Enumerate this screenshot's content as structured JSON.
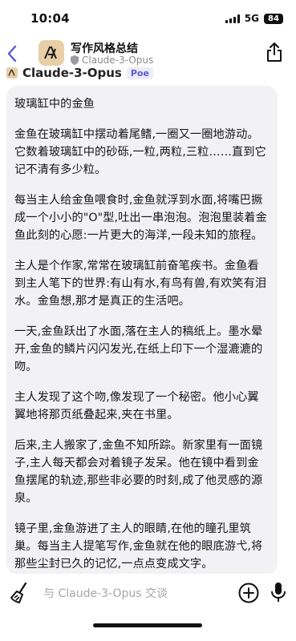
{
  "status_bar": {
    "time": "10:04",
    "network": "5G",
    "battery": "84"
  },
  "header": {
    "title": "写作风格总结",
    "subtitle": "Claude-3-Opus",
    "icons": [
      "back-chevron-icon",
      "bot-avatar-icon",
      "shield-icon",
      "share-icon"
    ]
  },
  "message": {
    "author": "Claude-3-Opus",
    "badge": "Poe",
    "paragraphs": [
      "玻璃缸中的金鱼",
      "金鱼在玻璃缸中摆动着尾鳍,一圈又一圈地游动。它数着玻璃缸中的砂砾,一粒,两粒,三粒……直到它记不清有多少粒。",
      "每当主人给金鱼喂食时,金鱼就浮到水面,将嘴巴撅成一个小小的\"O\"型,吐出一串泡泡。泡泡里装着金鱼此刻的心愿:一片更大的海洋,一段未知的旅程。",
      "主人是个作家,常常在玻璃缸前奋笔疾书。金鱼看到主人笔下的世界:有山有水,有鸟有兽,有欢笑有泪水。金鱼想,那才是真正的生活吧。",
      "一天,金鱼跃出了水面,落在主人的稿纸上。墨水晕开,金鱼的鳞片闪闪发光,在纸上印下一个湿漉漉的吻。",
      "主人发现了这个吻,像发现了一个秘密。他小心翼翼地将那页纸叠起来,夹在书里。",
      "后来,主人搬家了,金鱼不知所踪。新家里有一面镜子,主人每天都会对着镜子发呆。他在镜中看到金鱼摆尾的轨迹,那些非必要的时刻,成了他灵感的源泉。",
      "镜子里,金鱼游进了主人的眼睛,在他的瞳孔里筑巢。每当主人提笔写作,金鱼就在他的眼底游弋,将那些尘封已久的记忆,一点点变成文字。"
    ]
  },
  "input": {
    "placeholder": "与 Claude-3-Opus 交谈"
  },
  "colors": {
    "accent": "#5b5bd6",
    "bubble_bg": "#f2f2f5",
    "avatar_bg": "#e8cfa6",
    "back_chevron": "#5b5bd6"
  }
}
